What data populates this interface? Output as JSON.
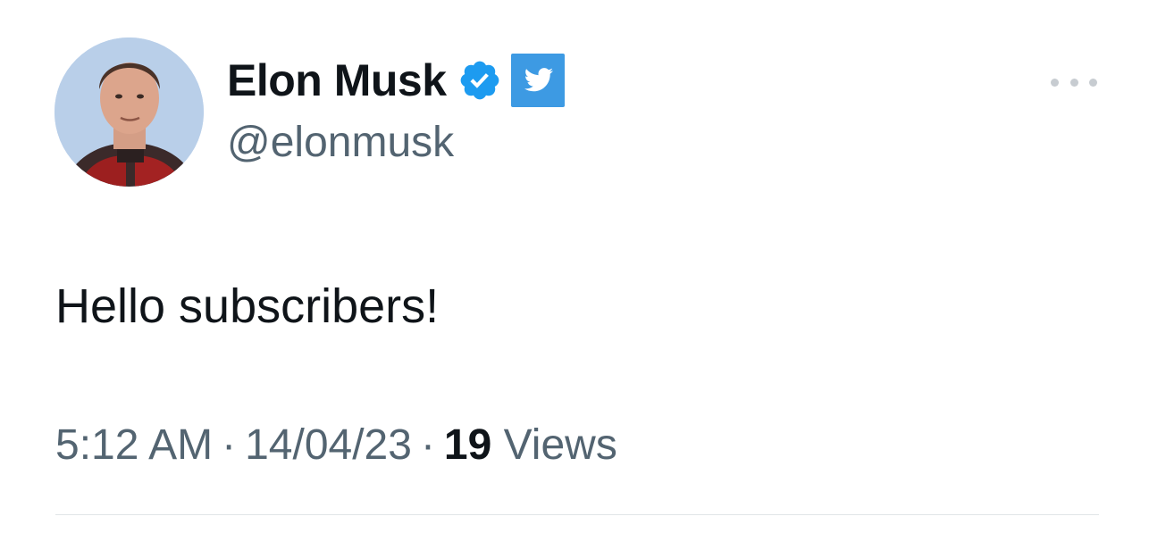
{
  "tweet": {
    "author": {
      "display_name": "Elon Musk",
      "handle": "@elonmusk",
      "avatar_icon": "profile-photo",
      "verified_icon": "verified-badge-icon",
      "affiliation_icon": "twitter-bird-icon"
    },
    "text": "Hello subscribers!",
    "meta": {
      "time": "5:12 AM",
      "separator": "·",
      "date": "14/04/23",
      "views_count": "19",
      "views_label": "Views"
    },
    "more_icon": "more-options-icon"
  },
  "colors": {
    "primary_text": "#0f1419",
    "secondary_text": "#536471",
    "verified_blue": "#1d9bf0",
    "twitter_tile_blue": "#3d9ae3",
    "divider": "#e1e5e8",
    "background": "#ffffff"
  }
}
